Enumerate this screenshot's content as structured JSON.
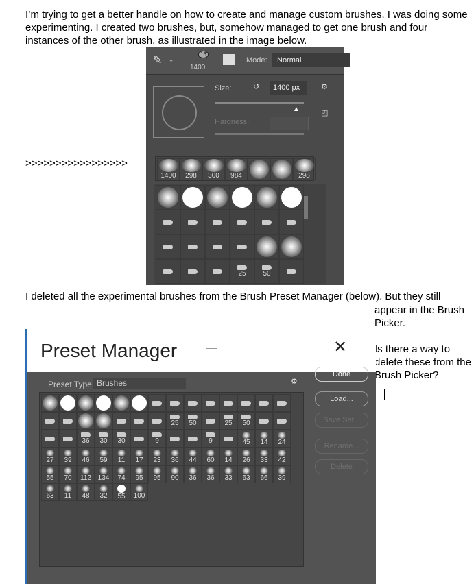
{
  "post": {
    "paragraph1": "I’m trying to get a better handle on how to create and manage custom brushes.  I was doing some experimenting.  I created two brushes, but, somehow managed to get one brush and four instances of the other brush, as illustrated in the image below.",
    "arrows": ">>>>>>>>>>>>>>>>>",
    "paragraph2": "I deleted all the experimental brushes from the Brush Preset Manager (below).  But they still",
    "side_text": "appear in the Brush Picker.",
    "question": "Is there a way to delete these from the Brush Picker?"
  },
  "brush_picker": {
    "current_size": "1400",
    "badge": "16",
    "mode_label": "Mode:",
    "mode_value": "Normal",
    "size_label": "Size:",
    "size_value": "1400 px",
    "size_fraction": 0.9,
    "hardness_label": "Hardness:",
    "recent": [
      {
        "t": "b",
        "n": "1400"
      },
      {
        "t": "b",
        "n": "298"
      },
      {
        "t": "b",
        "n": "300"
      },
      {
        "t": "b",
        "n": "984"
      },
      {
        "t": "soft",
        "n": ""
      },
      {
        "t": "soft",
        "n": ""
      },
      {
        "t": "b",
        "n": "298"
      }
    ],
    "grid": [
      {
        "t": "soft"
      },
      {
        "t": "hard"
      },
      {
        "t": "soft"
      },
      {
        "t": "hard"
      },
      {
        "t": "soft"
      },
      {
        "t": "hard"
      },
      {
        "t": "tip"
      },
      {
        "t": "tip"
      },
      {
        "t": "tip"
      },
      {
        "t": "tip"
      },
      {
        "t": "tip"
      },
      {
        "t": "tip"
      },
      {
        "t": "tip"
      },
      {
        "t": "tip"
      },
      {
        "t": "tip"
      },
      {
        "t": "tip"
      },
      {
        "t": "soft"
      },
      {
        "t": "soft"
      },
      {
        "t": "tip"
      },
      {
        "t": "tip"
      },
      {
        "t": "tip"
      },
      {
        "t": "tip",
        "n": "25"
      },
      {
        "t": "tip",
        "n": "50"
      },
      {
        "t": "tip"
      }
    ]
  },
  "preset_manager": {
    "title": "Preset Manager",
    "preset_type_label": "Preset Type:",
    "preset_type_value": "Brushes",
    "buttons": {
      "done": "Done",
      "load": "Load...",
      "save_set": "Save Set...",
      "rename": "Rename...",
      "delete": "Delete"
    },
    "brushes": [
      {
        "t": "soft"
      },
      {
        "t": "hard"
      },
      {
        "t": "soft"
      },
      {
        "t": "hard"
      },
      {
        "t": "soft"
      },
      {
        "t": "hard"
      },
      {
        "t": "tip"
      },
      {
        "t": "tip"
      },
      {
        "t": "tip"
      },
      {
        "t": "tip"
      },
      {
        "t": "tip"
      },
      {
        "t": "tip"
      },
      {
        "t": "tip"
      },
      {
        "t": "tip"
      },
      {
        "t": "tip"
      },
      {
        "t": "tip"
      },
      {
        "t": "soft"
      },
      {
        "t": "soft"
      },
      {
        "t": "tip"
      },
      {
        "t": "tip"
      },
      {
        "t": "tip"
      },
      {
        "t": "tip",
        "n": "25"
      },
      {
        "t": "tip",
        "n": "50"
      },
      {
        "t": "tip"
      },
      {
        "t": "tip",
        "n": "25"
      },
      {
        "t": "tip",
        "n": "50"
      },
      {
        "t": "tip"
      },
      {
        "t": "tip"
      },
      {
        "t": "tip"
      },
      {
        "t": "tip"
      },
      {
        "t": "tip",
        "n": "36"
      },
      {
        "t": "tip",
        "n": "30"
      },
      {
        "t": "tip",
        "n": "30"
      },
      {
        "t": "tip"
      },
      {
        "t": "tip",
        "n": "9"
      },
      {
        "t": "tip"
      },
      {
        "t": "tip"
      },
      {
        "t": "tip",
        "n": "9"
      },
      {
        "t": "tip"
      },
      {
        "t": "splat",
        "n": "45"
      },
      {
        "t": "splat",
        "n": "14"
      },
      {
        "t": "splat",
        "n": "24"
      },
      {
        "t": "splat",
        "n": "27"
      },
      {
        "t": "splat",
        "n": "39"
      },
      {
        "t": "splat",
        "n": "46"
      },
      {
        "t": "splat",
        "n": "59"
      },
      {
        "t": "splat",
        "n": "11"
      },
      {
        "t": "splat",
        "n": "17"
      },
      {
        "t": "splat",
        "n": "23"
      },
      {
        "t": "splat",
        "n": "36"
      },
      {
        "t": "splat",
        "n": "44"
      },
      {
        "t": "splat",
        "n": "60"
      },
      {
        "t": "splat",
        "n": "14"
      },
      {
        "t": "splat",
        "n": "26"
      },
      {
        "t": "splat",
        "n": "33"
      },
      {
        "t": "splat",
        "n": "42"
      },
      {
        "t": "splat",
        "n": "55"
      },
      {
        "t": "splat",
        "n": "70"
      },
      {
        "t": "splat",
        "n": "112"
      },
      {
        "t": "splat",
        "n": "134"
      },
      {
        "t": "splat",
        "n": "74"
      },
      {
        "t": "splat",
        "n": "95"
      },
      {
        "t": "splat",
        "n": "95"
      },
      {
        "t": "splat",
        "n": "90"
      },
      {
        "t": "splat",
        "n": "36"
      },
      {
        "t": "splat",
        "n": "36"
      },
      {
        "t": "splat",
        "n": "33"
      },
      {
        "t": "splat",
        "n": "63"
      },
      {
        "t": "splat",
        "n": "66"
      },
      {
        "t": "splat",
        "n": "39"
      },
      {
        "t": "splat",
        "n": "63"
      },
      {
        "t": "splat",
        "n": "11"
      },
      {
        "t": "splat",
        "n": "48"
      },
      {
        "t": "splat",
        "n": "32"
      },
      {
        "t": "hard",
        "n": "55"
      },
      {
        "t": "splat",
        "n": "100"
      }
    ]
  }
}
